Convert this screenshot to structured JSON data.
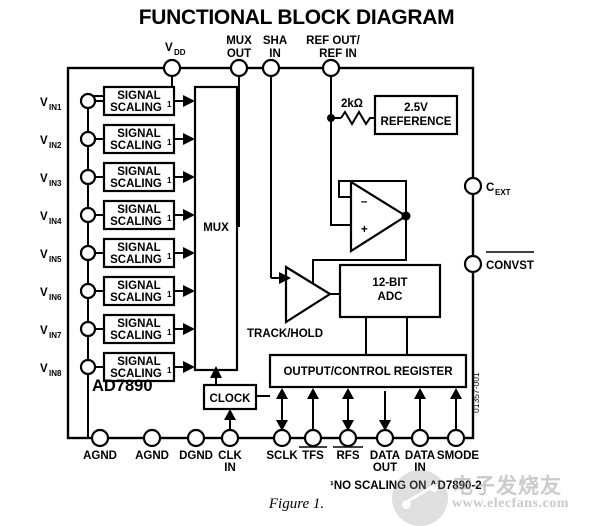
{
  "figure": {
    "title": "FUNCTIONAL BLOCK DIAGRAM",
    "caption": "Figure 1.",
    "part_label": "AD7890",
    "footnote": "¹NO SCALING ON AD7890-2",
    "doc_id": "01357-001"
  },
  "top_pins": [
    {
      "id": "vdd",
      "label": "V",
      "sub": "DD"
    },
    {
      "id": "mux-out",
      "line1": "MUX",
      "line2": "OUT"
    },
    {
      "id": "sha-in",
      "line1": "SHA",
      "line2": "IN"
    },
    {
      "id": "ref-out-ref-in",
      "line1": "REF OUT/",
      "line2": "REF IN"
    }
  ],
  "left_pins": [
    {
      "id": "vin1",
      "label": "V",
      "sub": "IN1"
    },
    {
      "id": "vin2",
      "label": "V",
      "sub": "IN2"
    },
    {
      "id": "vin3",
      "label": "V",
      "sub": "IN3"
    },
    {
      "id": "vin4",
      "label": "V",
      "sub": "IN4"
    },
    {
      "id": "vin5",
      "label": "V",
      "sub": "IN5"
    },
    {
      "id": "vin6",
      "label": "V",
      "sub": "IN6"
    },
    {
      "id": "vin7",
      "label": "V",
      "sub": "IN7"
    },
    {
      "id": "vin8",
      "label": "V",
      "sub": "IN8"
    }
  ],
  "right_pins": [
    {
      "id": "cext",
      "label": "C",
      "sub": "EXT",
      "overline": false
    },
    {
      "id": "convst",
      "label": "CONVST",
      "sub": "",
      "overline": true
    }
  ],
  "bottom_pins": [
    {
      "id": "agnd-1",
      "line1": "AGND",
      "line2": "",
      "overline": false
    },
    {
      "id": "agnd-2",
      "line1": "AGND",
      "line2": "",
      "overline": false
    },
    {
      "id": "dgnd",
      "line1": "DGND",
      "line2": "",
      "overline": false
    },
    {
      "id": "clk-in",
      "line1": "CLK",
      "line2": "IN",
      "overline": false
    },
    {
      "id": "sclk",
      "line1": "SCLK",
      "line2": "",
      "overline": false
    },
    {
      "id": "tfs",
      "line1": "TFS",
      "line2": "",
      "overline": true
    },
    {
      "id": "rfs",
      "line1": "RFS",
      "line2": "",
      "overline": true
    },
    {
      "id": "data-out",
      "line1": "DATA",
      "line2": "OUT",
      "overline": false
    },
    {
      "id": "data-in",
      "line1": "DATA",
      "line2": "IN",
      "overline": false
    },
    {
      "id": "smode",
      "line1": "SMODE",
      "line2": "",
      "overline": false
    }
  ],
  "blocks": {
    "signal_scaling": {
      "line1": "SIGNAL",
      "line2": "SCALING",
      "sup": "1",
      "count": 8
    },
    "mux": {
      "label": "MUX"
    },
    "reference": {
      "line1": "2.5V",
      "line2": "REFERENCE"
    },
    "resistor": {
      "label": "2kΩ"
    },
    "adc": {
      "line1": "12-BIT",
      "line2": "ADC"
    },
    "track_hold": {
      "label": "TRACK/HOLD"
    },
    "clock": {
      "label": "CLOCK"
    },
    "register": {
      "label": "OUTPUT/CONTROL REGISTER"
    },
    "opamp": {
      "minus": "–",
      "plus": "+"
    }
  },
  "watermark": {
    "chinese": "电子发烧友",
    "url": "www.elecfans.com"
  },
  "colors": {
    "ink": "#000000",
    "paper": "#ffffff"
  }
}
